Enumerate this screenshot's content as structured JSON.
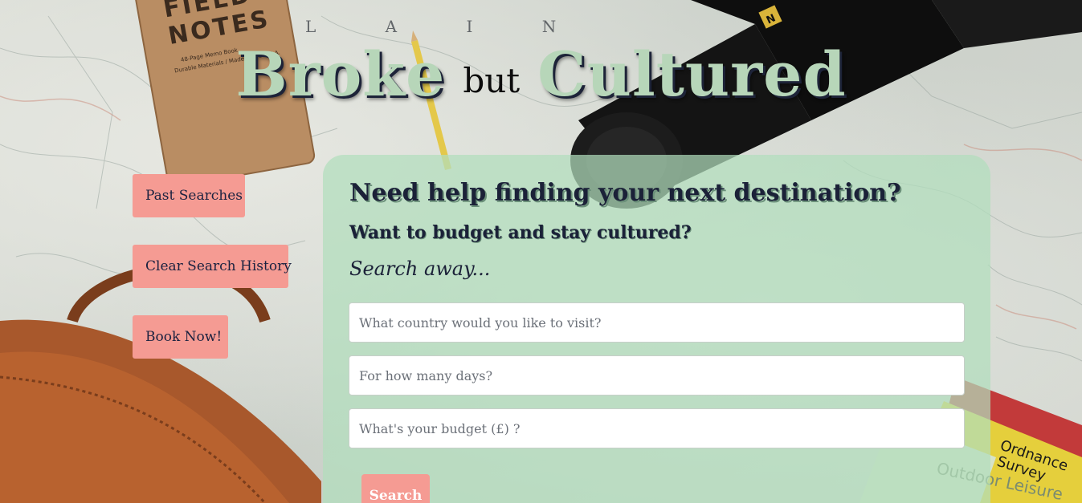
{
  "title": {
    "word1": "Broke",
    "word2": "but",
    "word3": "Cultured"
  },
  "sidebar": {
    "past_searches": "Past Searches",
    "clear_history": "Clear Search History",
    "book_now": "Book Now!"
  },
  "card": {
    "heading": "Need help finding your next destination?",
    "subheading": "Want to budget and stay cultured?",
    "tagline": "Search away...",
    "country_placeholder": "What country would you like to visit?",
    "days_placeholder": "For how many days?",
    "budget_placeholder": "What's your budget (£) ?",
    "search_label": "Search"
  },
  "background": {
    "notebook_line1": "FIELD",
    "notebook_line2": "NOTES",
    "notebook_caption1": "48-Page Memo Book",
    "notebook_caption2": "Durable Materials / Made in the U.S.A.",
    "map_letters": "L A I N",
    "ordnance_label1": "Ordnance",
    "ordnance_label2": "Survey",
    "outdoor_label": "Outdoor Leisure",
    "camera_badge": "N"
  },
  "colors": {
    "accent_button": "#f59b93",
    "title_green": "#b7d6b9",
    "card_green": "#b2debc",
    "text_navy": "#1b2138"
  }
}
